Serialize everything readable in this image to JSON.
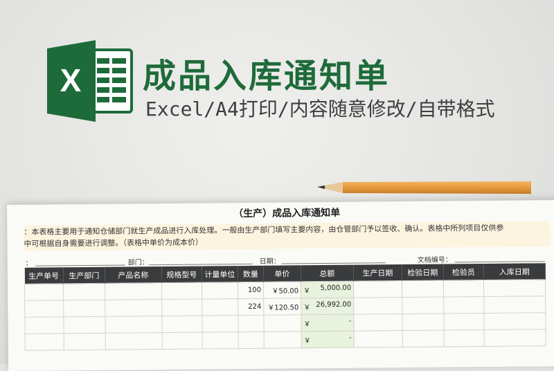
{
  "header": {
    "title": "成品入库通知单",
    "subtitle": "Excel/A4打印/内容随意修改/自带格式"
  },
  "logo": {
    "icon": "excel-logo-icon",
    "letter": "X",
    "color": "#1e6b3a"
  },
  "document": {
    "title": "（生产）成品入库通知单",
    "note_line1": "：本表格主要用于通知仓储部门就生产成品进行入库处理。一般由生产部门填写主要内容，由仓管部门予以签收、确认。表格中所列项目仅供参",
    "note_line2": "中可根据自身需要进行调整。（表格中单价为成本价）",
    "meta": {
      "first_label": "：",
      "dept_label": "部门：",
      "date_label": "日期：",
      "doc_no_label": "文档编号："
    },
    "columns": [
      "生产单号",
      "生产部门",
      "产品名称",
      "规格型号",
      "计量单位",
      "数量",
      "单价",
      "总额",
      "生产日期",
      "检验日期",
      "检验员",
      "入库日期"
    ],
    "rows": [
      {
        "qty": "100",
        "price": "￥50.00",
        "yen": "￥",
        "total": "5,000.00"
      },
      {
        "qty": "224",
        "price": "￥120.50",
        "yen": "￥",
        "total": "26,992.00"
      },
      {
        "qty": "",
        "price": "",
        "yen": "￥",
        "total": "-"
      },
      {
        "qty": "",
        "price": "",
        "yen": "￥",
        "total": "-"
      }
    ]
  },
  "colors": {
    "brand_green": "#1e6b3a",
    "header_dark": "#3a3b3d",
    "total_bg": "#e8f2dc",
    "note_bg": "#fdf4e0"
  }
}
